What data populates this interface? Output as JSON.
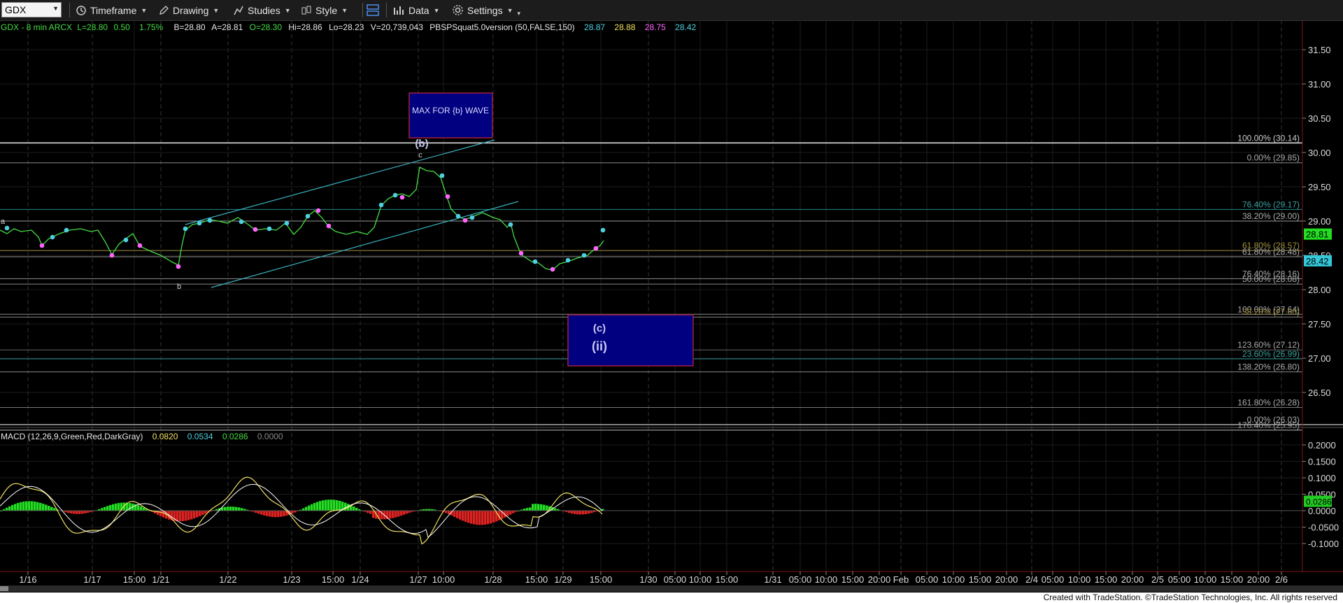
{
  "toolbar": {
    "symbol": "GDX",
    "items": [
      {
        "label": "Timeframe",
        "icon": "clock-icon"
      },
      {
        "label": "Drawing",
        "icon": "pencil-icon"
      },
      {
        "label": "Studies",
        "icon": "studies-icon"
      },
      {
        "label": "Style",
        "icon": "style-icon"
      },
      {
        "label": "",
        "icon": "layout-icon"
      },
      {
        "label": "Data",
        "icon": "bar-chart-icon"
      },
      {
        "label": "Settings",
        "icon": "gear-icon"
      }
    ]
  },
  "legend": {
    "title": "GDX - 8 min  ARCX",
    "last": "L=28.80",
    "change": "0.50",
    "change_pct": "1.75%",
    "bid": "B=28.80",
    "ask": "A=28.81",
    "open": "O=28.30",
    "high": "Hi=28.86",
    "low": "Lo=28.23",
    "volume": "V=20,739,043",
    "study": "PBSPSquat5.0version (50,FALSE,150)",
    "study_values": [
      "28.87",
      "28.88",
      "28.75",
      "28.42"
    ],
    "study_colors": [
      "#4fd0e0",
      "#f0e060",
      "#ff66ff",
      "#4fd0e0"
    ]
  },
  "macd_legend": {
    "label": "MACD (12,26,9,Green,Red,DarkGray)",
    "values": [
      "0.0820",
      "0.0534",
      "0.0286",
      "0.0000"
    ],
    "colors": [
      "#f0e060",
      "#4fd0e0",
      "#44dd44",
      "#888888"
    ]
  },
  "price_axis": {
    "ticks": [
      "31.50",
      "31.00",
      "30.50",
      "30.00",
      "29.50",
      "29.00",
      "28.50",
      "28.00",
      "27.50",
      "27.00",
      "26.50"
    ],
    "tick_values": [
      31.5,
      31.0,
      30.5,
      30.0,
      29.5,
      29.0,
      28.5,
      28.0,
      27.5,
      27.0,
      26.5
    ],
    "badges": [
      {
        "text": "28.81",
        "value": 28.81,
        "color": "#22dd22"
      },
      {
        "text": "28.42",
        "value": 28.42,
        "color": "#33c8d8"
      }
    ]
  },
  "macd_axis": {
    "ticks": [
      "0.2000",
      "0.1500",
      "0.1000",
      "0.0500",
      "0.0000",
      "-0.0500",
      "-0.1000"
    ],
    "tick_values": [
      0.2,
      0.15,
      0.1,
      0.05,
      0.0,
      -0.05,
      -0.1
    ],
    "badge": {
      "text": "0.0286",
      "value": 0.0286,
      "color": "#22cc22"
    }
  },
  "time_axis": {
    "ticks": [
      "1/16",
      "1/17",
      "15:00",
      "1/21",
      "1/22",
      "1/23",
      "15:00",
      "1/24",
      "1/27",
      "10:00",
      "1/28",
      "15:00",
      "1/29",
      "15:00",
      "1/30",
      "05:00",
      "10:00",
      "15:00",
      "1/31",
      "05:00",
      "10:00",
      "15:00",
      "20:00",
      "Feb",
      "05:00",
      "10:00",
      "15:00",
      "20:00",
      "2/4",
      "05:00",
      "10:00",
      "15:00",
      "20:00",
      "2/5",
      "05:00",
      "10:00",
      "15:00",
      "20:00",
      "2/6"
    ]
  },
  "fib_labels": [
    {
      "text": "100.00% (30.14)",
      "value": 30.14,
      "color": "#cccccc"
    },
    {
      "text": "0.00% (29.85)",
      "value": 29.85,
      "color": "#aaaaaa"
    },
    {
      "text": "76.40% (29.17)",
      "value": 29.17,
      "color": "#3aa0a0"
    },
    {
      "text": "38.20% (29.00)",
      "value": 29.0,
      "color": "#aaaaaa"
    },
    {
      "text": "61.80% (28.57)",
      "value": 28.57,
      "color": "#a09040"
    },
    {
      "text": "61.80% (28.48)",
      "value": 28.48,
      "color": "#aaaaaa"
    },
    {
      "text": "76.40% (28.16)",
      "value": 28.16,
      "color": "#aaaaaa"
    },
    {
      "text": "50.00% (28.08)",
      "value": 28.08,
      "color": "#aaaaaa"
    },
    {
      "text": "100.00% (27.64)",
      "value": 27.64,
      "color": "#aaaaaa"
    },
    {
      "text": "38.20% (27.60)",
      "value": 27.6,
      "color": "#a09040"
    },
    {
      "text": "123.60% (27.12)",
      "value": 27.12,
      "color": "#aaaaaa"
    },
    {
      "text": "23.60% (26.99)",
      "value": 26.99,
      "color": "#3aa0a0"
    },
    {
      "text": "138.20% (26.80)",
      "value": 26.8,
      "color": "#aaaaaa"
    },
    {
      "text": "161.80% (26.28)",
      "value": 26.28,
      "color": "#aaaaaa"
    },
    {
      "text": "0.00% (26.03)",
      "value": 26.03,
      "color": "#aaaaaa"
    },
    {
      "text": "176.40% (25.95)",
      "value": 25.95,
      "color": "#aaaaaa"
    }
  ],
  "annotations": {
    "b_box_label": "MAX FOR {b} WAVE",
    "wave_b_paren": "(b)",
    "wave_c_small": "c",
    "wave_a_small": "a",
    "wave_b_small": "b",
    "target_c": "(c)",
    "target_ii": "(ii)"
  },
  "footer": "Created with TradeStation. ©TradeStation Technologies, Inc. All rights reserved",
  "colors": {
    "price_line": "#44dd44",
    "macd_line": "#f0e060",
    "signal_line": "#ffffff",
    "hist_up": "#22dd22",
    "hist_down": "#dd2222",
    "box_fill": "#000080",
    "box_border": "#a02040",
    "channel": "#3ab0c0"
  },
  "chart_data": {
    "type": "line",
    "series": [],
    "price_range": [
      26.0,
      31.6
    ],
    "macd_range": [
      -0.13,
      0.23
    ],
    "channel_lines": [],
    "target_zone": {
      "top": 27.64,
      "bottom": 26.88
    },
    "b_max_zone": {
      "top": 30.85,
      "bottom": 30.2
    },
    "grid": true
  }
}
